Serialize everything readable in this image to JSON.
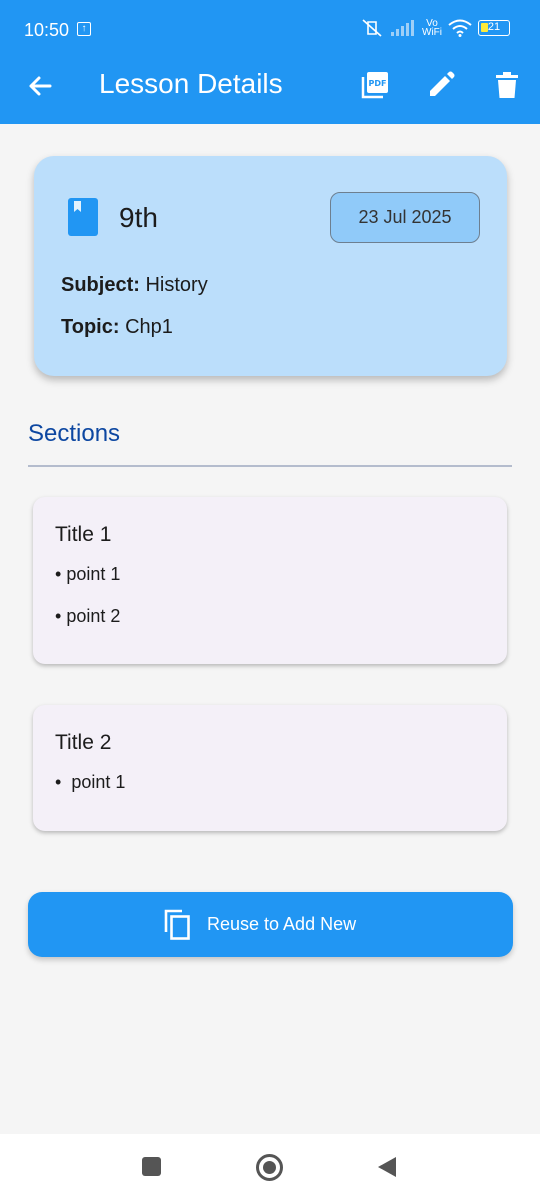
{
  "status": {
    "time": "10:50",
    "vowifi_top": "Vo",
    "vowifi_bottom": "WiFi",
    "battery": "21"
  },
  "appbar": {
    "title": "Lesson Details",
    "icons": [
      "back-arrow-icon",
      "pdf-icon",
      "edit-icon",
      "delete-icon"
    ]
  },
  "lesson": {
    "grade": "9th",
    "date": "23 Jul 2025",
    "subject_label": "Subject:",
    "subject": "History",
    "topic_label": "Topic:",
    "topic": "Chp1"
  },
  "sections_heading": "Sections",
  "sections": [
    {
      "title": "Title 1",
      "points": [
        "point 1",
        "point 2"
      ]
    },
    {
      "title": "Title 2",
      "points": [
        "point 1"
      ]
    }
  ],
  "reuse_button": {
    "label": "Reuse to Add New"
  },
  "colors": {
    "primary": "#2196f3",
    "card": "#bbdefb",
    "chip": "#90caf9",
    "heading": "#0d47a1"
  }
}
